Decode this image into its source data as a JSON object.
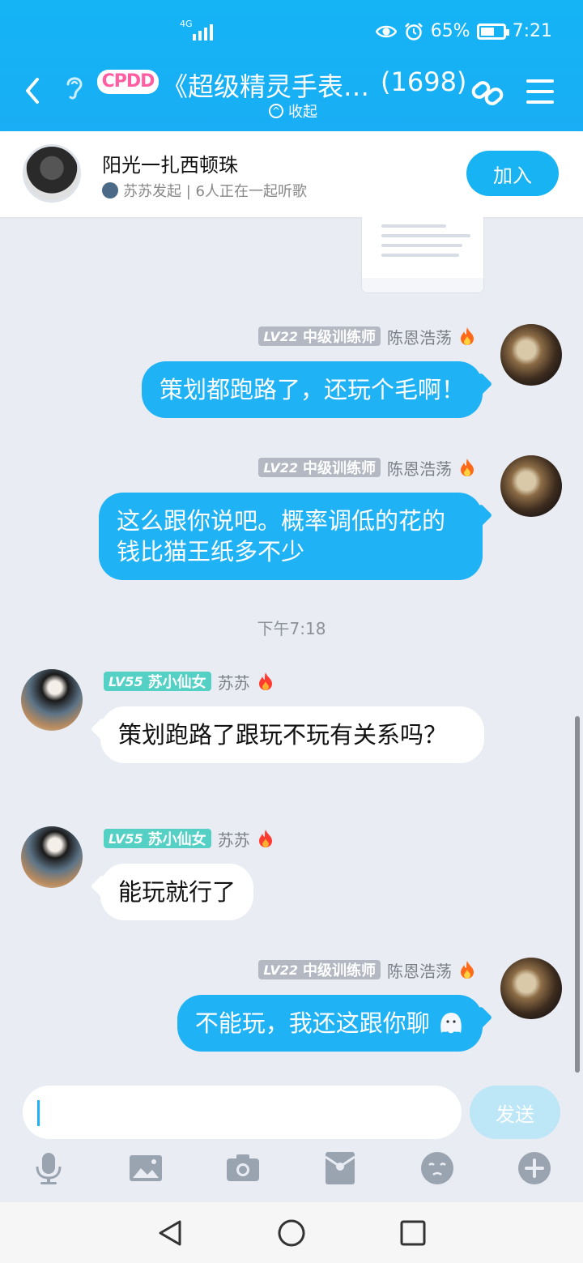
{
  "status_bar": {
    "network": "4G",
    "battery_percent": "65%",
    "time": "7:21",
    "battery_level": 0.65
  },
  "header": {
    "logo_text": "CPDD",
    "title": "《超级精灵手表…",
    "member_count": "(1698)",
    "collapse_label": "收起"
  },
  "music": {
    "song_title": "阳光一扎西顿珠",
    "subtitle": "苏苏发起 | 6人正在一起听歌",
    "join_label": "加入"
  },
  "messages": [
    {
      "side": "me",
      "level": "LV22",
      "title": "中级训练师",
      "name": "陈恩浩荡",
      "text": "策划都跑路了，还玩个毛啊！"
    },
    {
      "side": "me",
      "level": "LV22",
      "title": "中级训练师",
      "name": "陈恩浩荡",
      "text": "这么跟你说吧。概率调低的花的钱比猫王纸多不少"
    },
    {
      "time": "下午7:18"
    },
    {
      "side": "them",
      "level": "LV55",
      "title": "苏小仙女",
      "name": "苏苏",
      "text": "策划跑路了跟玩不玩有关系吗？"
    },
    {
      "side": "them",
      "level": "LV55",
      "title": "苏小仙女",
      "name": "苏苏",
      "text": "能玩就行了"
    },
    {
      "side": "me",
      "level": "LV22",
      "title": "中级训练师",
      "name": "陈恩浩荡",
      "text": "不能玩，我还这跟你聊"
    }
  ],
  "input": {
    "value": "",
    "send_label": "发送"
  },
  "toolbar_icons": [
    "microphone-icon",
    "image-icon",
    "camera-icon",
    "red-packet-icon",
    "emoji-icon",
    "plus-icon"
  ],
  "colors": {
    "brand": "#17b3f3",
    "bubble_me": "#1fb2f5",
    "tag_gray": "#b3b8c3",
    "tag_cyan": "#54d0c4"
  }
}
